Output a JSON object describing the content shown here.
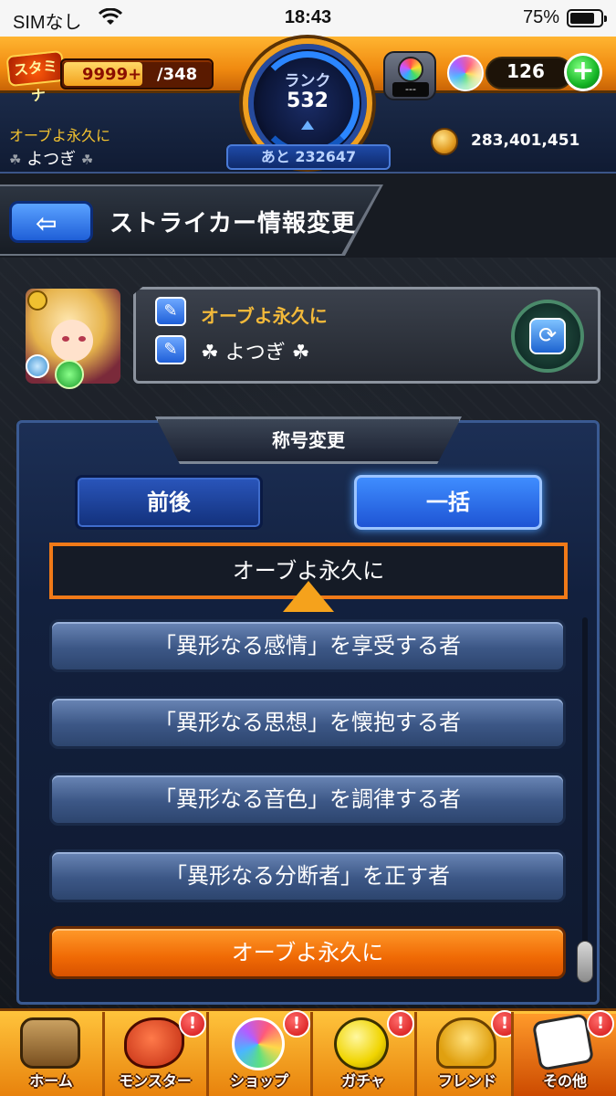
{
  "status_bar": {
    "carrier": "SIMなし",
    "time": "18:43",
    "battery": "75%"
  },
  "header": {
    "stamina_label": "スタミナ",
    "stamina_current": "9999+",
    "stamina_max": "/348",
    "rank_label": "ランク",
    "rank_value": "532",
    "exp_remaining": "あと 232647",
    "capsule_screen": "---",
    "orb_count": "126",
    "plus_label": "+",
    "user_title": "オーブよ永久に",
    "user_name": "よつぎ",
    "clover": "☘",
    "coins": "283,401,451"
  },
  "page": {
    "title": "ストライカー情報変更",
    "back_icon": "⇦"
  },
  "profile": {
    "title": "オーブよ永久に",
    "name": "よつぎ",
    "edit_icon": "✎",
    "swap_icon": "⟳"
  },
  "title_change": {
    "heading": "称号変更",
    "mode_buttons": [
      {
        "label": "前後"
      },
      {
        "label": "一括"
      }
    ],
    "active_mode": "一括",
    "preview": "オーブよ永久に",
    "options": [
      {
        "label": "「異形なる感情」を享受する者"
      },
      {
        "label": "「異形なる思想」を懐抱する者"
      },
      {
        "label": "「異形なる音色」を調律する者"
      },
      {
        "label": "「異形なる分断者」を正す者"
      },
      {
        "label": "オーブよ永久に"
      }
    ],
    "selected_option": "オーブよ永久に"
  },
  "tabbar": {
    "tabs": [
      {
        "label": "ホーム",
        "alert": ""
      },
      {
        "label": "モンスター",
        "alert": "!"
      },
      {
        "label": "ショップ",
        "alert": "!"
      },
      {
        "label": "ガチャ",
        "alert": "!"
      },
      {
        "label": "フレンド",
        "alert": "!"
      },
      {
        "label": "その他",
        "alert": "!"
      }
    ],
    "active_tab": "その他"
  },
  "colors": {
    "accent_orange": "#f07a18",
    "header_orange": "#f08a10",
    "button_blue": "#1e54d4",
    "title_gold": "#f2b93a"
  }
}
